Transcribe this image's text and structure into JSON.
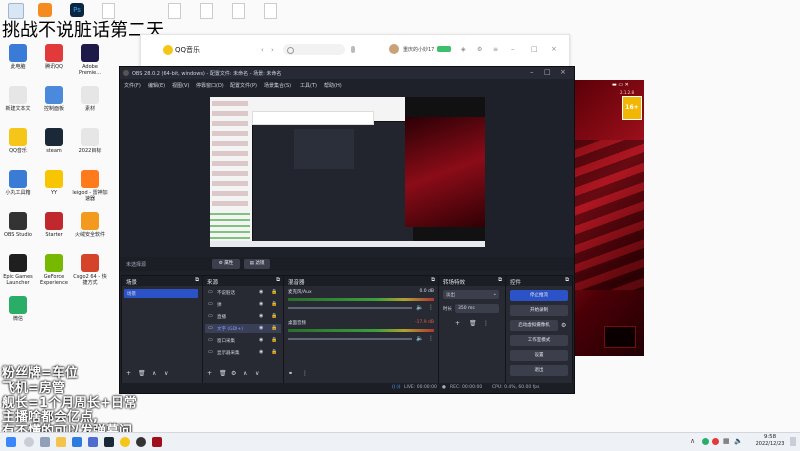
{
  "colors": {
    "obs_bg": "#1f212a",
    "obs_accent": "#2c52c8",
    "taskbar": "#eef1f6",
    "overlay_text": "#ffffff"
  },
  "desktop": {
    "stream_title": "挑战不说脏话第二天",
    "overlay_lines": [
      "粉丝牌=车位",
      "飞机=房管",
      "舰长=1个月周长+日常",
      "主播啥都会亿点,",
      "有不懂的可以发弹幕问"
    ],
    "icons": [
      {
        "label": "此电脑",
        "icon": "computer-icon",
        "color": "#3b7bd8"
      },
      {
        "label": "腾讯QQ",
        "icon": "qq-icon",
        "color": "#e23a3a"
      },
      {
        "label": "Adobe Premie...",
        "icon": "premiere-icon",
        "color": "#1d1a4a"
      },
      {
        "label": "新建文本文",
        "icon": "text-file-icon",
        "color": "#e6e6e6"
      },
      {
        "label": "控制面板",
        "icon": "control-panel-icon",
        "color": "#4a89dc"
      },
      {
        "label": "素材",
        "icon": "folder-icon",
        "color": "#e6e6e6"
      },
      {
        "label": "QQ音乐",
        "icon": "qq-music-icon",
        "color": "#f5c518"
      },
      {
        "label": "steam",
        "icon": "steam-icon",
        "color": "#1b2838"
      },
      {
        "label": "2022目标",
        "icon": "file-icon",
        "color": "#e6e6e6"
      },
      {
        "label": "小丸工具箱",
        "icon": "toolbox-icon",
        "color": "#3a7bd5"
      },
      {
        "label": "YY",
        "icon": "yy-icon",
        "color": "#f7c600"
      },
      {
        "label": "leigod - 雷神加速器",
        "icon": "leigod-icon",
        "color": "#ff7a1a"
      },
      {
        "label": "OBS Studio",
        "icon": "obs-icon",
        "color": "#333333"
      },
      {
        "label": "Starter",
        "icon": "starter-icon",
        "color": "#c0282d"
      },
      {
        "label": "火绒安全软件",
        "icon": "huorong-icon",
        "color": "#f39a1e"
      },
      {
        "label": "Epic Games Launcher",
        "icon": "epic-icon",
        "color": "#1f1f1f"
      },
      {
        "label": "GeForce Experience",
        "icon": "geforce-icon",
        "color": "#76b900"
      },
      {
        "label": "Csgo2 64 - 快捷方式",
        "icon": "game-icon",
        "color": "#d4432a"
      },
      {
        "label": "微信",
        "icon": "wechat-icon",
        "color": "#2aae67"
      }
    ],
    "top_files": [
      "",
      "",
      "",
      "",
      "",
      "",
      ""
    ]
  },
  "qqmusic": {
    "title": "QQ音乐",
    "search_placeholder": "",
    "user": "重庆的小妙17"
  },
  "obs": {
    "title": "OBS 28.0.2 (64-bit, windows) - 配置文件: 未命名 - 场景: 未命名",
    "menu": [
      "文件(F)",
      "编辑(E)",
      "视图(V)",
      "停靠窗口(D)",
      "配置文件(P)",
      "场景集合(S)",
      "工具(T)",
      "帮助(H)"
    ],
    "no_source": "未选择源",
    "prop_btn": "属性",
    "filter_btn": "滤镜",
    "scenes": {
      "title": "场景",
      "items": [
        "场景"
      ]
    },
    "sources": {
      "title": "来源",
      "items": [
        "不说脏话",
        "弹",
        "直播",
        "文字 (GDI+)",
        "窗口采集",
        "显示器采集"
      ]
    },
    "mixer": {
      "title": "混音器",
      "tracks": [
        {
          "name": "麦克风/Aux",
          "db": "0.0 dB"
        },
        {
          "name": "桌面音频",
          "db": "-17.9 dB"
        }
      ]
    },
    "transitions": {
      "title": "转场特效",
      "type": "淡出",
      "duration_label": "时长",
      "duration": "350 ms"
    },
    "controls": {
      "title": "控件",
      "buttons": [
        "停止推流",
        "开始录制",
        "启动虚拟摄像机",
        "工作室模式",
        "设置",
        "退出"
      ]
    },
    "status": {
      "live": "LIVE: 00:00:00",
      "rec": "REC: 00:00:00",
      "cpu": "CPU: 0.4%, 60.00 fps"
    }
  },
  "game": {
    "version": "2.1.2.8",
    "rating": "16+"
  },
  "taskbar": {
    "time": "9:58",
    "date": "2022/12/23"
  }
}
